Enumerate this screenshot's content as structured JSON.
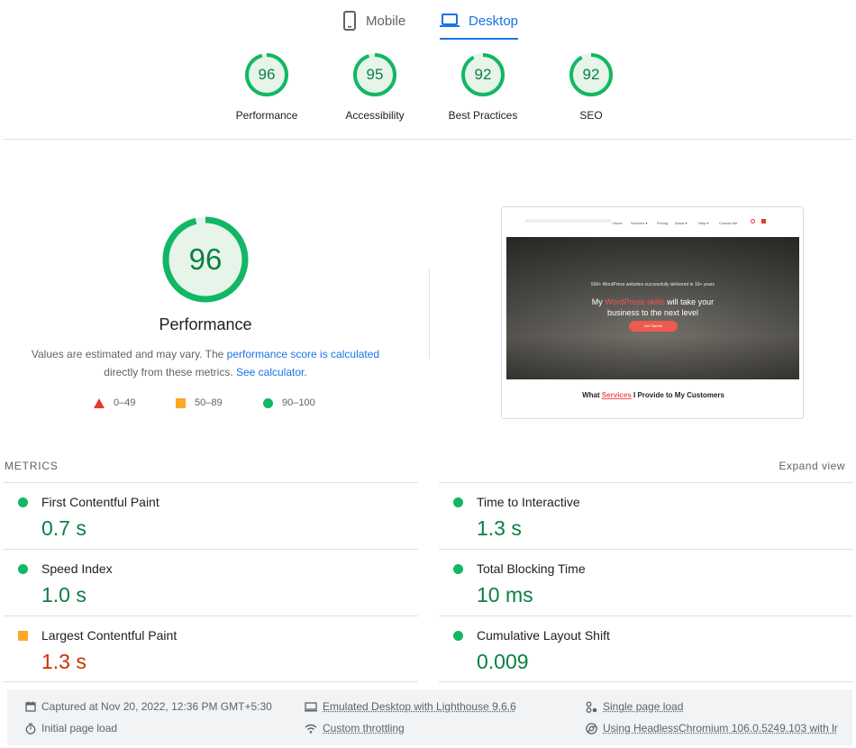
{
  "tabs": [
    {
      "label": "Mobile",
      "icon": "smartphone-icon",
      "active": false
    },
    {
      "label": "Desktop",
      "icon": "laptop-icon",
      "active": true
    }
  ],
  "summary": [
    {
      "score": "96",
      "label": "Performance",
      "fraction": 0.96
    },
    {
      "score": "95",
      "label": "Accessibility",
      "fraction": 0.95
    },
    {
      "score": "92",
      "label": "Best Practices",
      "fraction": 0.92
    },
    {
      "score": "92",
      "label": "SEO",
      "fraction": 0.92
    }
  ],
  "performance": {
    "score": "96",
    "fraction": 0.96,
    "title": "Performance",
    "desc_part1": "Values are estimated and may vary. The ",
    "desc_link1": "performance score is calculated",
    "desc_part2": " directly from these metrics. ",
    "desc_link2": "See calculator",
    "desc_part3": "."
  },
  "legend": [
    {
      "range": "0–49",
      "shape": "triangle",
      "color": "#e53935"
    },
    {
      "range": "50–89",
      "shape": "square",
      "color": "#ffa726"
    },
    {
      "range": "90–100",
      "shape": "circle",
      "color": "#12b763"
    }
  ],
  "thumbnail": {
    "nav_items": [
      "Home",
      "Services ▾",
      "Pricing",
      "About ▾",
      "Help ▾",
      "Contact Me"
    ],
    "hero_small": "500+ WordPress websites successfully delivered in 10+ years",
    "hero_line1_pre": "My ",
    "hero_line1_accent": "WordPress skills",
    "hero_line1_post": " will take your",
    "hero_line2": "business to the next level",
    "hero_button": "Get Started",
    "caption_pre": "What ",
    "caption_accent": "Services",
    "caption_post": " I Provide to My Customers"
  },
  "metrics": {
    "heading": "METRICS",
    "expand_label": "Expand view",
    "items": [
      {
        "name": "First Contentful Paint",
        "value": "0.7 s",
        "status": "good"
      },
      {
        "name": "Time to Interactive",
        "value": "1.3 s",
        "status": "good"
      },
      {
        "name": "Speed Index",
        "value": "1.0 s",
        "status": "good"
      },
      {
        "name": "Total Blocking Time",
        "value": "10 ms",
        "status": "good"
      },
      {
        "name": "Largest Contentful Paint",
        "value": "1.3 s",
        "status": "average"
      },
      {
        "name": "Cumulative Layout Shift",
        "value": "0.009",
        "status": "good"
      }
    ]
  },
  "footer": {
    "captured": "Captured at Nov 20, 2022, 12:36 PM GMT+5:30",
    "initial_load": "Initial page load",
    "emulated": "Emulated Desktop with Lighthouse 9.6.6",
    "throttling": "Custom throttling",
    "single_page": "Single page load",
    "browser": "Using HeadlessChromium 106.0.5249.103 with lr"
  },
  "colors": {
    "good": "#0b8043",
    "good_fill": "#12b763",
    "average": "#c33300",
    "average_fill": "#ffa726",
    "accent": "#1a73e8"
  }
}
